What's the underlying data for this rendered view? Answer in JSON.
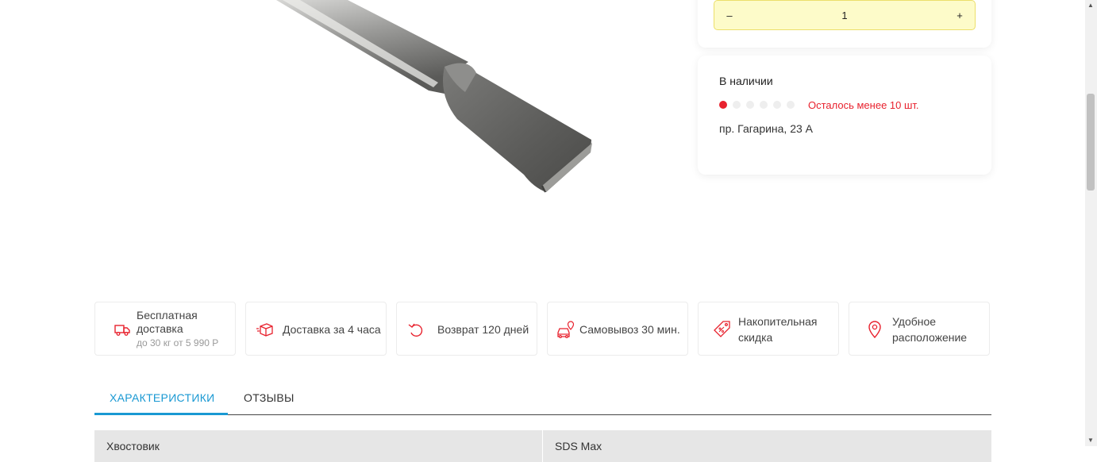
{
  "quantity": {
    "value": "1",
    "minus": "–",
    "plus": "+"
  },
  "stock": {
    "title": "В наличии",
    "level_filled": 1,
    "level_total": 6,
    "note": "Осталось менее 10 шт.",
    "address": "пр. Гагарина, 23 А"
  },
  "features": [
    {
      "icon": "delivery-truck-icon",
      "label_line1": "Бесплатная",
      "label_line2": "доставка",
      "sub": "до 30 кг от 5 990 Р"
    },
    {
      "icon": "box-icon",
      "label": "Доставка за 4 часа"
    },
    {
      "icon": "return-arrow-icon",
      "label": "Возврат 120 дней"
    },
    {
      "icon": "pickup-car-icon",
      "label": "Самовывоз 30 мин."
    },
    {
      "icon": "discount-tag-icon",
      "label_line1": "Накопительная",
      "label_line2": "скидка"
    },
    {
      "icon": "location-pin-icon",
      "label_line1": "Удобное",
      "label_line2": "расположение"
    }
  ],
  "tabs": {
    "specs": "ХАРАКТЕРИСТИКИ",
    "reviews": "ОТЗЫВЫ"
  },
  "spec_row": {
    "name": "Хвостовик",
    "value": "SDS Max"
  },
  "colors": {
    "accent_red": "#e8222e",
    "accent_blue": "#1a99d3",
    "qty_bg": "#fdfbc9"
  }
}
